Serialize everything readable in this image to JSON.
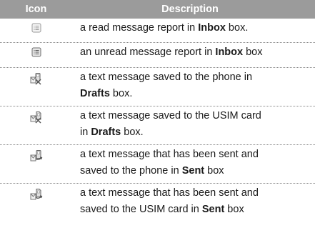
{
  "header": {
    "icon_col": "Icon",
    "desc_col": "Description"
  },
  "rows": [
    {
      "icon": "read-report-icon",
      "lines": [
        {
          "pre": "a read message report  in ",
          "bold": "Inbox",
          "post": " box."
        }
      ]
    },
    {
      "icon": "unread-report-icon",
      "lines": [
        {
          "pre": "an unread message report in ",
          "bold": "Inbox",
          "post": " box"
        }
      ]
    },
    {
      "icon": "draft-phone-icon",
      "lines": [
        {
          "pre": "a text message saved to the phone in",
          "bold": "",
          "post": ""
        },
        {
          "pre": "",
          "bold": "Drafts",
          "post": " box."
        }
      ]
    },
    {
      "icon": "draft-usim-icon",
      "lines": [
        {
          "pre": "a text message saved to the USIM card",
          "bold": "",
          "post": ""
        },
        {
          "pre": "in ",
          "bold": "Drafts",
          "post": " box."
        }
      ]
    },
    {
      "icon": "sent-phone-icon",
      "lines": [
        {
          "pre": "a text message that has been sent and",
          "bold": "",
          "post": ""
        },
        {
          "pre": "saved to the phone in ",
          "bold": "Sent",
          "post": " box"
        }
      ]
    },
    {
      "icon": "sent-usim-icon",
      "lines": [
        {
          "pre": "a text message that has been sent and",
          "bold": "",
          "post": ""
        },
        {
          "pre": "saved to the USIM card in ",
          "bold": "Sent",
          "post": " box"
        }
      ]
    }
  ]
}
